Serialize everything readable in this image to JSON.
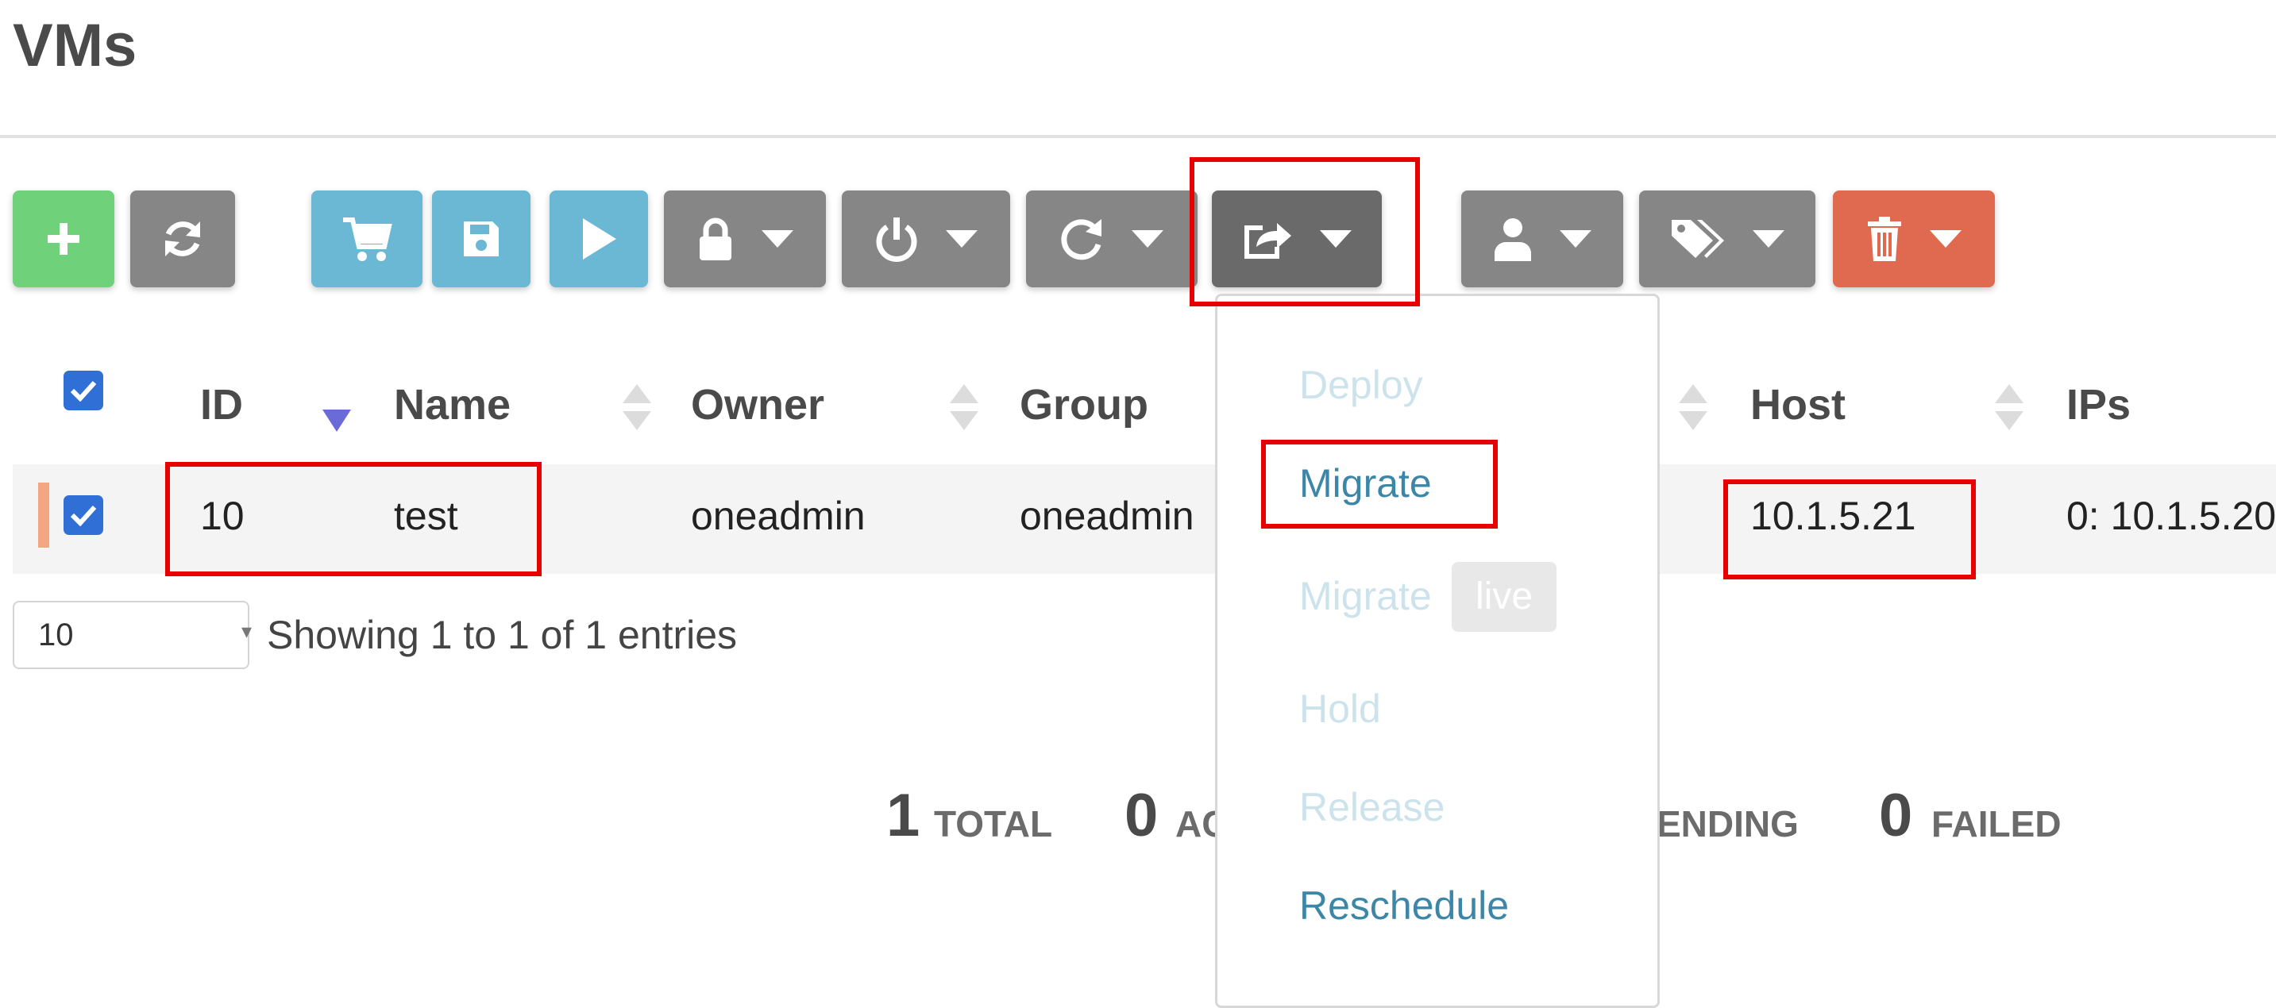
{
  "page": {
    "title": "VMs"
  },
  "toolbar": {
    "buttons": [
      {
        "name": "create",
        "icon": "plus-icon",
        "color": "#6fd27a"
      },
      {
        "name": "refresh",
        "icon": "refresh-icon",
        "color": "#868686"
      },
      {
        "name": "marketplace",
        "icon": "cart-icon",
        "color": "#6bb8d4"
      },
      {
        "name": "save",
        "icon": "save-icon",
        "color": "#6bb8d4"
      },
      {
        "name": "play",
        "icon": "play-icon",
        "color": "#6bb8d4"
      },
      {
        "name": "lock",
        "icon": "lock-icon",
        "color": "#868686"
      },
      {
        "name": "power",
        "icon": "power-icon",
        "color": "#868686"
      },
      {
        "name": "reboot",
        "icon": "reboot-icon",
        "color": "#868686"
      },
      {
        "name": "migrate",
        "icon": "share-icon",
        "color": "#6a6a6a",
        "active": true
      },
      {
        "name": "owner",
        "icon": "user-icon",
        "color": "#868686"
      },
      {
        "name": "labels",
        "icon": "tags-icon",
        "color": "#868686"
      },
      {
        "name": "delete",
        "icon": "trash-icon",
        "color": "#e06a50"
      }
    ]
  },
  "table": {
    "columns": [
      "ID",
      "Name",
      "Owner",
      "Group",
      "Host",
      "IPs"
    ],
    "sorted_column": "ID",
    "rows": [
      {
        "id": "10",
        "name": "test",
        "owner": "oneadmin",
        "group": "oneadmin",
        "host": "10.1.5.21",
        "ips": "0: 10.1.5.20",
        "checked": true
      }
    ],
    "select_all_checked": true
  },
  "pagination": {
    "page_size": "10",
    "info": "Showing 1 to 1 of 1 entries"
  },
  "stats": [
    {
      "value": "1",
      "label": "TOTAL"
    },
    {
      "value": "0",
      "label": "AC"
    },
    {
      "value": "",
      "label": "ENDING"
    },
    {
      "value": "0",
      "label": "FAILED"
    }
  ],
  "dropdown": {
    "items": [
      {
        "label": "Deploy",
        "enabled": false
      },
      {
        "label": "Migrate",
        "enabled": true
      },
      {
        "label": "Migrate",
        "badge": "live",
        "enabled": false
      },
      {
        "label": "Hold",
        "enabled": false
      },
      {
        "label": "Release",
        "enabled": false
      },
      {
        "label": "Reschedule",
        "enabled": true
      }
    ]
  },
  "colors": {
    "accent_red_highlight": "#e60000",
    "link": "#3c87a8",
    "checkbox": "#2f6fd6"
  }
}
